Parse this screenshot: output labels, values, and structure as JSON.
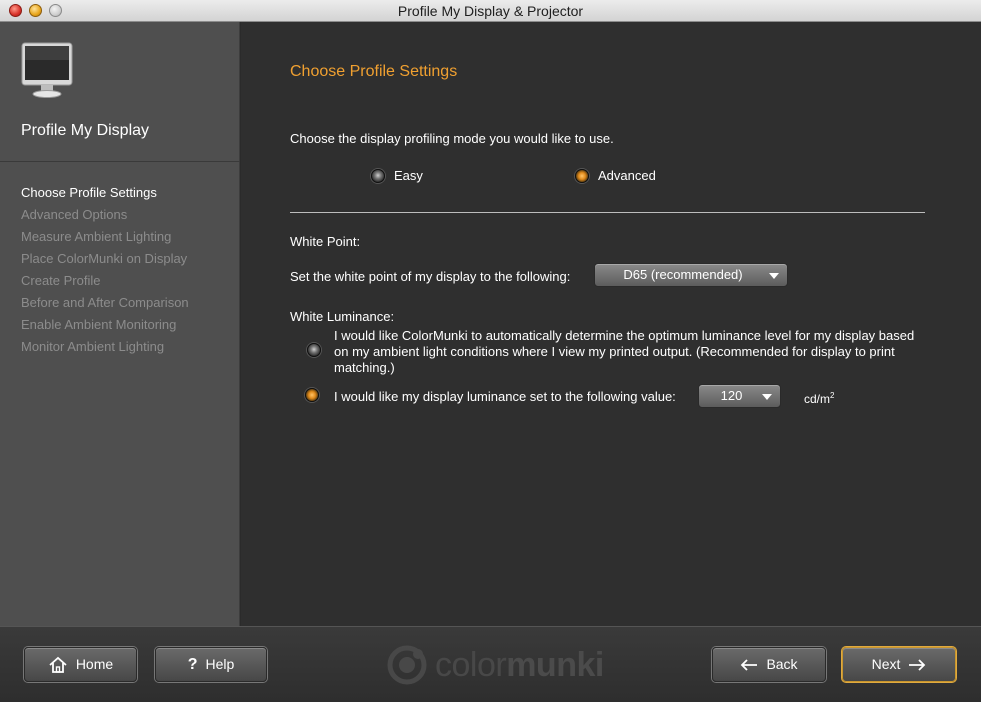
{
  "window": {
    "title": "Profile My Display & Projector"
  },
  "sidebar": {
    "title": "Profile My Display",
    "steps": [
      "Choose Profile Settings",
      "Advanced Options",
      "Measure Ambient Lighting",
      "Place ColorMunki on Display",
      "Create Profile",
      "Before and After Comparison",
      "Enable Ambient Monitoring",
      "Monitor Ambient Lighting"
    ],
    "active_step": "Choose Profile Settings"
  },
  "main": {
    "heading": "Choose Profile Settings",
    "mode_prompt": "Choose the display profiling mode you would like to use.",
    "modes": {
      "easy": "Easy",
      "advanced": "Advanced",
      "selected": "Advanced"
    },
    "white_point": {
      "label": "White Point:",
      "prompt": "Set the white point of my display to the following:",
      "value": "D65 (recommended)"
    },
    "white_luminance": {
      "label": "White Luminance:",
      "option_auto": "I would like ColorMunki to automatically determine the optimum luminance level for my  display based on my ambient light conditions where I view my printed output.  (Recommended for display to print matching.)",
      "option_manual": "I would like my display luminance set to the following value:",
      "value": "120",
      "unit": "cd/m",
      "unit_sup": "2",
      "selected": "manual"
    }
  },
  "footer": {
    "home": "Home",
    "help": "Help",
    "logo_light": "color",
    "logo_bold": "munki",
    "back": "Back",
    "next": "Next"
  },
  "colors": {
    "accent": "#f0a030",
    "panel": "#2f2f2f",
    "sidebar": "#4f4f4f"
  }
}
